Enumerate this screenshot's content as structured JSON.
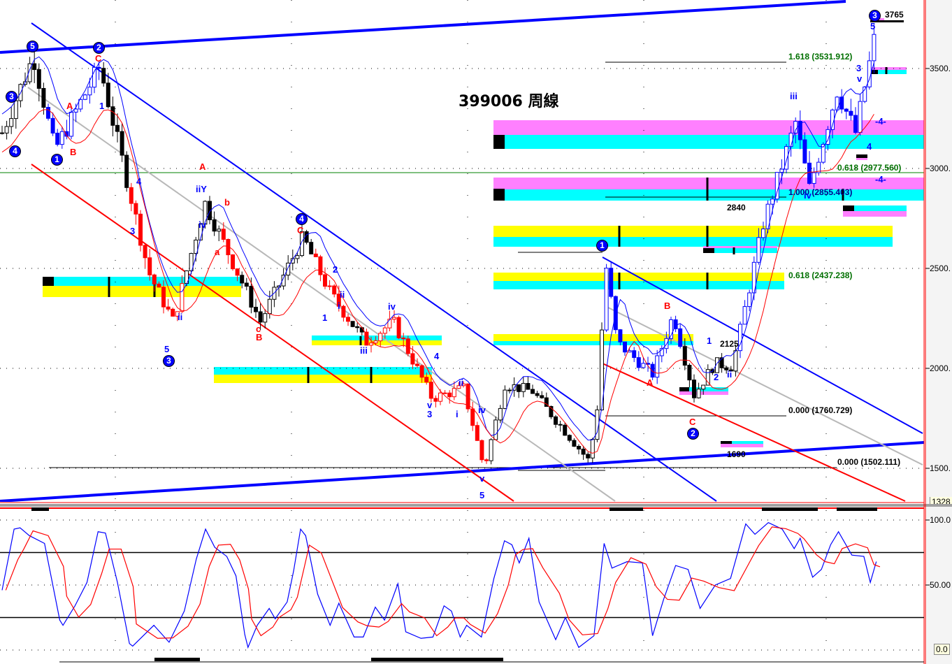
{
  "title": "399006 周線",
  "price_axis": {
    "labels": [
      "3500.",
      "3000.",
      "2500.",
      "2000.",
      "1500."
    ],
    "min_label": "1328"
  },
  "osc_axis": {
    "labels": [
      "100.0",
      "50.00"
    ],
    "min_label": "0.0"
  },
  "fib_labels": [
    {
      "text": "1.618 (3531.912)",
      "color": "#007000"
    },
    {
      "text": "0.618 (2977.560)",
      "color": "#007000"
    },
    {
      "text": "1.000 (2855.403)",
      "color": "#00008b"
    },
    {
      "text": "0.618 (2437.238)",
      "color": "#007000"
    },
    {
      "text": "0.000 (1760.729)",
      "color": "#000000"
    },
    {
      "text": "0.000 (1502.111)",
      "color": "#000000"
    }
  ],
  "price_notes": [
    "3765",
    "2840",
    "1690",
    "2125"
  ],
  "wave_labels": {
    "circled": [
      "5",
      "3",
      "4",
      "1",
      "2",
      "3",
      "4",
      "1",
      "2",
      "3"
    ],
    "red": [
      "A",
      "B",
      "C",
      "A",
      "b",
      "a",
      "c",
      "B",
      "C",
      "A",
      "B",
      "C"
    ],
    "blue": [
      "1",
      "4",
      "3",
      "5",
      "ii",
      "iiY",
      "iv",
      "2",
      "ii",
      "i",
      "1",
      "iii",
      "iv",
      "4",
      "v",
      "3",
      "ii",
      "i",
      "iv",
      "v",
      "5",
      "1",
      "2",
      "ii",
      "iii",
      "iv",
      "3",
      "v",
      "5",
      "4",
      "-4-",
      "-4-"
    ]
  },
  "chart_data": {
    "type": "candlestick",
    "title": "399006 周線",
    "xlabel": "",
    "ylabel": "",
    "ylim": [
      1328,
      3800
    ],
    "x_unit": "week index",
    "swing_points": [
      [
        0,
        3178
      ],
      [
        6.8,
        3563
      ],
      [
        11.4,
        3090
      ],
      [
        21.2,
        3510
      ],
      [
        31.8,
        2480
      ],
      [
        37.1,
        2234
      ],
      [
        43.9,
        2830
      ],
      [
        56,
        2234
      ],
      [
        65.2,
        2654
      ],
      [
        71.2,
        2374
      ],
      [
        78.8,
        2130
      ],
      [
        84.8,
        2234
      ],
      [
        93.2,
        1850
      ],
      [
        100,
        1900
      ],
      [
        104.5,
        1500
      ],
      [
        109,
        1920
      ],
      [
        115,
        1885
      ],
      [
        127.3,
        1535
      ],
      [
        129.5,
        1885
      ],
      [
        130.6,
        2566
      ],
      [
        133.3,
        2130
      ],
      [
        141,
        1972
      ],
      [
        145.5,
        2270
      ],
      [
        150,
        1867
      ],
      [
        154.5,
        2025
      ],
      [
        158.3,
        2010
      ],
      [
        165,
        2724
      ],
      [
        172,
        3230
      ],
      [
        175,
        2900
      ],
      [
        181,
        3390
      ],
      [
        185,
        3180
      ],
      [
        189.4,
        3685
      ]
    ],
    "candle_colors": [
      [
        0,
        10,
        "#000000"
      ],
      [
        10,
        22,
        "#0000ff"
      ],
      [
        22,
        28,
        "#000000"
      ],
      [
        28,
        40,
        "#ff0000"
      ],
      [
        40,
        48,
        "#000000"
      ],
      [
        48,
        52,
        "#ff0000"
      ],
      [
        52,
        68,
        "#000000"
      ],
      [
        68,
        76,
        "#ff0000"
      ],
      [
        76,
        79,
        "#000000"
      ],
      [
        79,
        106,
        "#ff0000"
      ],
      [
        106,
        130,
        "#000000"
      ],
      [
        130,
        131,
        "#000000"
      ],
      [
        131,
        148,
        "#0000ff"
      ],
      [
        148,
        160,
        "#000000"
      ],
      [
        160,
        190,
        "#0000ff"
      ]
    ],
    "oscillator": {
      "name": "Stochastic",
      "ylim": [
        0,
        100
      ],
      "levels": [
        25,
        75
      ],
      "k": [
        [
          0,
          46
        ],
        [
          2.6,
          93
        ],
        [
          3.9,
          94
        ],
        [
          5.9,
          88
        ],
        [
          9.2,
          82
        ],
        [
          12.5,
          23
        ],
        [
          13.2,
          19
        ],
        [
          15.8,
          34
        ],
        [
          18.4,
          52
        ],
        [
          20.8,
          91
        ],
        [
          22.4,
          90
        ],
        [
          25,
          52
        ],
        [
          27.6,
          5
        ],
        [
          28.3,
          3
        ],
        [
          32.9,
          19
        ],
        [
          36.2,
          6
        ],
        [
          39.5,
          30
        ],
        [
          42.1,
          70
        ],
        [
          44.1,
          93
        ],
        [
          46.1,
          79
        ],
        [
          48.7,
          72
        ],
        [
          50.7,
          57
        ],
        [
          52.6,
          12
        ],
        [
          53.3,
          2
        ],
        [
          55.3,
          19
        ],
        [
          57.9,
          32
        ],
        [
          59.2,
          24
        ],
        [
          61.8,
          37
        ],
        [
          63.2,
          61
        ],
        [
          64.7,
          93
        ],
        [
          65.8,
          88
        ],
        [
          68.4,
          43
        ],
        [
          71.1,
          19
        ],
        [
          73,
          36
        ],
        [
          76.3,
          10
        ],
        [
          78.3,
          10
        ],
        [
          80.9,
          33
        ],
        [
          82.9,
          23
        ],
        [
          85.8,
          51
        ],
        [
          87.5,
          14
        ],
        [
          90.8,
          9
        ],
        [
          93.4,
          10
        ],
        [
          95.8,
          34
        ],
        [
          97.4,
          30
        ],
        [
          99.3,
          10
        ],
        [
          100.7,
          19
        ],
        [
          103.9,
          10
        ],
        [
          106.6,
          55
        ],
        [
          108.9,
          84
        ],
        [
          110.5,
          81
        ],
        [
          112.1,
          67
        ],
        [
          114.2,
          86
        ],
        [
          116.4,
          37
        ],
        [
          120,
          8
        ],
        [
          122.1,
          25
        ],
        [
          125,
          2
        ],
        [
          128.3,
          11
        ],
        [
          130.5,
          82
        ],
        [
          132.2,
          63
        ],
        [
          135.5,
          68
        ],
        [
          138.8,
          67
        ],
        [
          141,
          11
        ],
        [
          143.4,
          39
        ],
        [
          146,
          65
        ],
        [
          148.7,
          62
        ],
        [
          151.3,
          32
        ],
        [
          154.6,
          50
        ],
        [
          157.9,
          55
        ],
        [
          161.2,
          97
        ],
        [
          163.2,
          89
        ],
        [
          166.1,
          98
        ],
        [
          169.1,
          93
        ],
        [
          171.7,
          78
        ],
        [
          173,
          86
        ],
        [
          175.7,
          56
        ],
        [
          177.6,
          62
        ],
        [
          179.6,
          81
        ],
        [
          181.3,
          91
        ],
        [
          184.2,
          73
        ],
        [
          186.8,
          72
        ],
        [
          188.2,
          52
        ],
        [
          189.5,
          68
        ]
      ]
    }
  }
}
